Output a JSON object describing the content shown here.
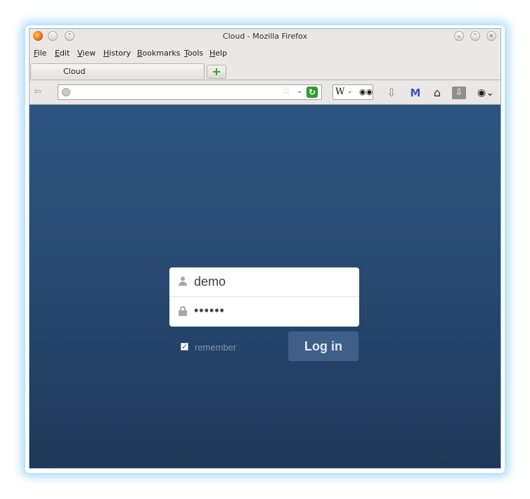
{
  "window": {
    "title": "Cloud - Mozilla Firefox"
  },
  "menubar": {
    "items": [
      "File",
      "Edit",
      "View",
      "History",
      "Bookmarks",
      "Tools",
      "Help"
    ]
  },
  "tabs": [
    {
      "label": "Cloud"
    }
  ],
  "navbar": {
    "url": "",
    "search_engine": "W"
  },
  "login": {
    "username": "demo",
    "password_mask": "••••••",
    "remember_label": "remember",
    "remember_checked": true,
    "submit_label": "Log in"
  },
  "colors": {
    "background_top": "#2f5481",
    "background_bottom": "#1f3858",
    "button": "#3d5f88"
  }
}
